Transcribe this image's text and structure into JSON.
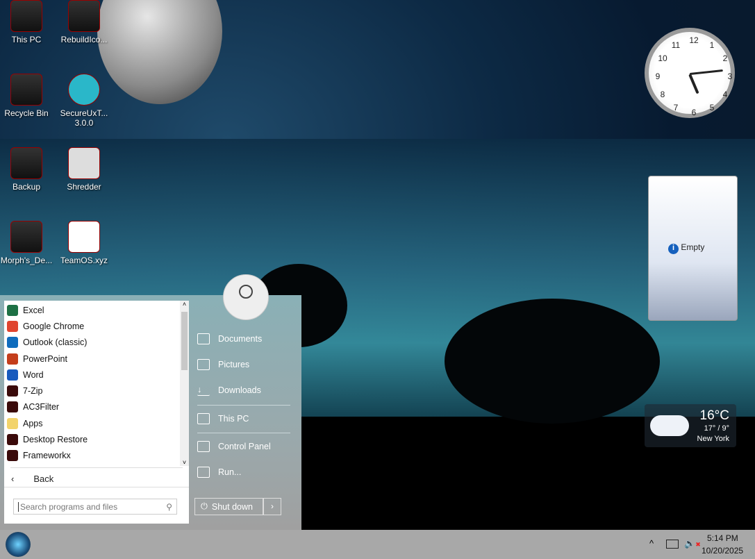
{
  "desktop_icons": [
    {
      "label": "This PC"
    },
    {
      "label": "RebuildIco..."
    },
    {
      "label": "Recycle Bin"
    },
    {
      "label": "SecureUxT... 3.0.0"
    },
    {
      "label": "Backup"
    },
    {
      "label": "Shredder"
    },
    {
      "label": "Morph's_De..."
    },
    {
      "label": "TeamOS.xyz"
    }
  ],
  "clock": {
    "numbers": [
      "12",
      "1",
      "2",
      "3",
      "4",
      "5",
      "6",
      "7",
      "8",
      "9",
      "10",
      "11"
    ],
    "time": "5:14"
  },
  "gadget": {
    "status": "Empty"
  },
  "weather": {
    "temp": "16°C",
    "range": "17° / 9°",
    "city": "New York"
  },
  "start_menu": {
    "programs": [
      {
        "label": "Excel",
        "color": "#1d7044"
      },
      {
        "label": "Google Chrome",
        "color": "#e0452f"
      },
      {
        "label": "Outlook (classic)",
        "color": "#0f6cbd"
      },
      {
        "label": "PowerPoint",
        "color": "#c43e1c"
      },
      {
        "label": "Word",
        "color": "#185abd"
      },
      {
        "label": "7-Zip",
        "color": "#3a0a0a"
      },
      {
        "label": "AC3Filter",
        "color": "#3a0a0a"
      },
      {
        "label": "Apps",
        "color": "#f2d36b"
      },
      {
        "label": "Desktop Restore",
        "color": "#3a0a0a"
      },
      {
        "label": "Frameworkx",
        "color": "#3a0a0a"
      }
    ],
    "back": "Back",
    "search_placeholder": "Search programs and files",
    "places": [
      "Documents",
      "Pictures",
      "Downloads",
      "This PC",
      "Control Panel",
      "Run..."
    ],
    "shutdown": "Shut down"
  },
  "taskbar": {
    "time": "5:14 PM",
    "date": "10/20/2025"
  }
}
